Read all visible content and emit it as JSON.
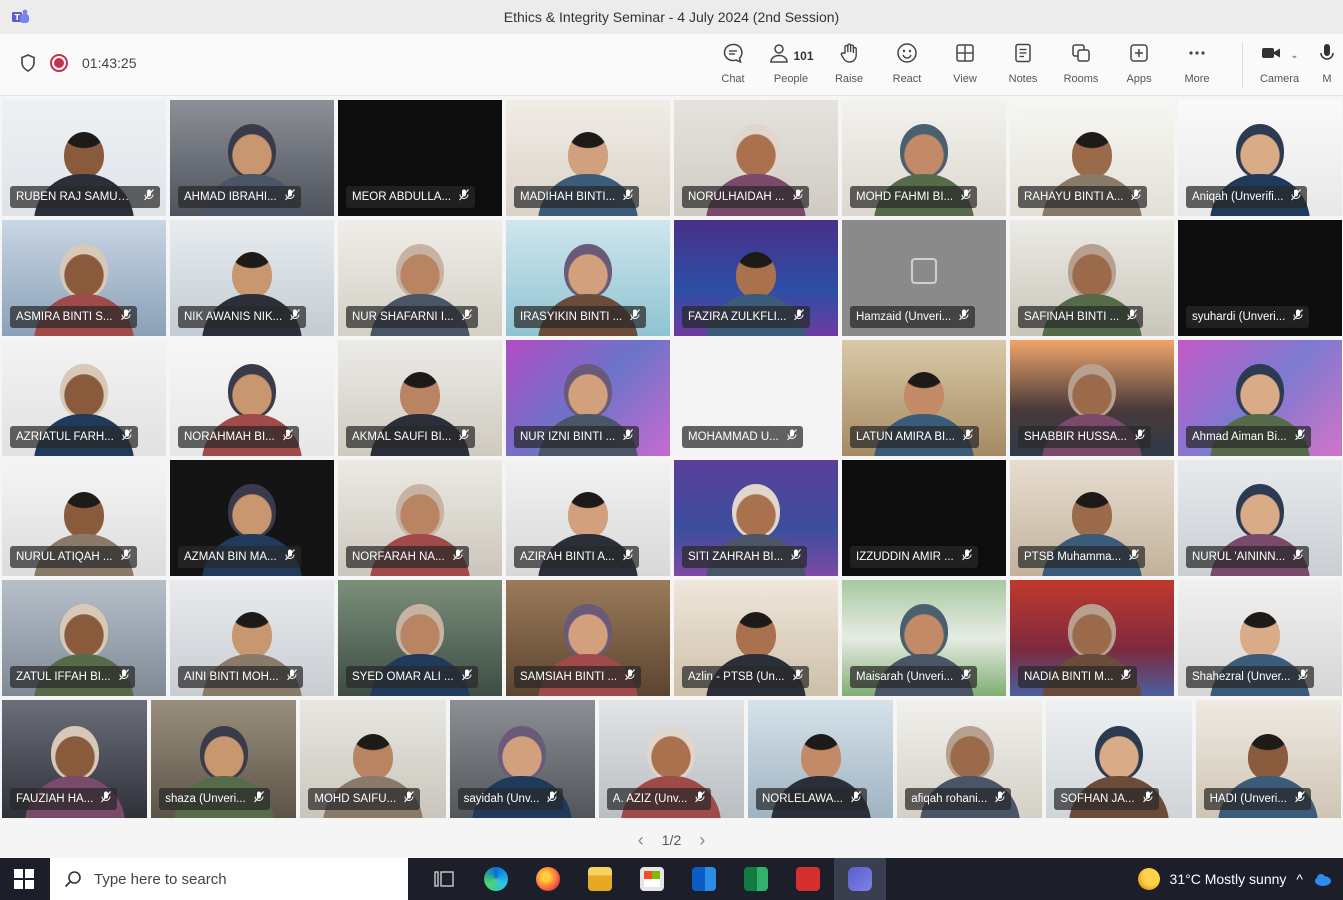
{
  "window": {
    "title": "Ethics & Integrity Seminar - 4 July 2024 (2nd Session)"
  },
  "toolbar": {
    "timer": "01:43:25",
    "tools": [
      {
        "id": "chat",
        "label": "Chat",
        "icon": "chat-icon"
      },
      {
        "id": "people",
        "label": "People",
        "icon": "people-icon",
        "count": "101"
      },
      {
        "id": "raise",
        "label": "Raise",
        "icon": "hand-icon"
      },
      {
        "id": "react",
        "label": "React",
        "icon": "smiley-icon"
      },
      {
        "id": "view",
        "label": "View",
        "icon": "grid-icon"
      },
      {
        "id": "notes",
        "label": "Notes",
        "icon": "notes-icon"
      },
      {
        "id": "rooms",
        "label": "Rooms",
        "icon": "rooms-icon"
      },
      {
        "id": "apps",
        "label": "Apps",
        "icon": "apps-icon"
      },
      {
        "id": "more",
        "label": "More",
        "icon": "more-icon"
      }
    ],
    "camera_label": "Camera",
    "mic_label": "M"
  },
  "participants": [
    "RUBEN RAJ SAMUEL ...",
    "AHMAD IBRAHI...",
    "MEOR ABDULLA...",
    "MADIHAH BINTI...",
    "NORULHAIDAH ...",
    "MOHD FAHMI BI...",
    "RAHAYU BINTI A...",
    "Aniqah (Unverifi...",
    "ASMIRA BINTI S...",
    "NIK AWANIS NIK...",
    "NUR SHAFARNI I...",
    "IRASYIKIN BINTI ...",
    "FAZIRA ZULKFLI...",
    "Hamzaid (Unveri...",
    "SAFINAH BINTI ...",
    "syuhardi (Unveri...",
    "AZRIATUL FARH...",
    "NORAHMAH BI...",
    "AKMAL SAUFI BI...",
    "NUR IZNI BINTI ...",
    "MOHAMMAD U...",
    "LATUN AMIRA BI...",
    "SHABBIR HUSSA...",
    "Ahmad Aiman Bi...",
    "NURUL ATIQAH ...",
    "AZMAN BIN MA...",
    "NORFARAH NA...",
    "AZIRAH BINTI A...",
    "SITI ZAHRAH BI...",
    "IZZUDDIN AMIR ...",
    "PTSB Muhamma...",
    "NURUL 'AININN...",
    "ZATUL IFFAH BI...",
    "AINI BINTI MOH...",
    "SYED OMAR ALI ...",
    "SAMSIAH BINTI ...",
    "Azlin - PTSB (Un...",
    "Maisarah (Unveri...",
    "NADIA BINTI M...",
    "Shahezral (Unver...",
    "FAUZIAH HA...",
    "shaza (Unveri...",
    "MOHD SAIFU...",
    "sayidah (Unv...",
    "A. AZIZ (Unv...",
    "NORLELAWA...",
    "afiqah rohani...",
    "SOFHAN JA...",
    "HADI (Unveri..."
  ],
  "pager": {
    "label": "1/2"
  },
  "taskbar": {
    "search_placeholder": "Type here to search",
    "weather": "31°C  Mostly sunny"
  }
}
